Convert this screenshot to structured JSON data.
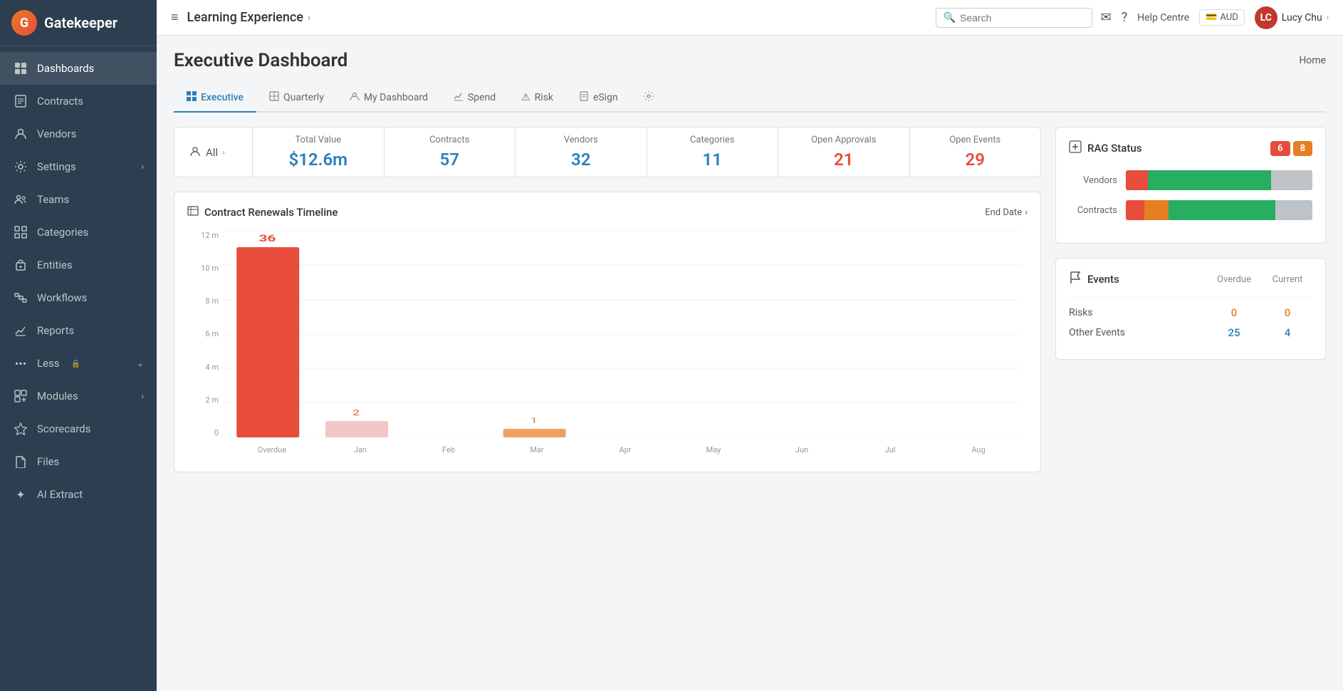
{
  "app": {
    "name": "Gatekeeper",
    "logo_letter": "G"
  },
  "topbar": {
    "menu_icon": "≡",
    "breadcrumb": "Learning Experience",
    "breadcrumb_arrow": "›",
    "search_placeholder": "Search",
    "help_centre": "Help Centre",
    "currency": "AUD",
    "user_name": "Lucy Chu",
    "user_initials": "LC",
    "user_arrow": "›"
  },
  "sidebar": {
    "items": [
      {
        "id": "dashboards",
        "label": "Dashboards",
        "icon": "⊞",
        "active": true,
        "has_arrow": false
      },
      {
        "id": "contracts",
        "label": "Contracts",
        "icon": "📄",
        "active": false,
        "has_arrow": false
      },
      {
        "id": "vendors",
        "label": "Vendors",
        "icon": "👥",
        "active": false,
        "has_arrow": false
      },
      {
        "id": "settings",
        "label": "Settings",
        "icon": "⚙",
        "active": false,
        "has_arrow": true
      },
      {
        "id": "teams",
        "label": "Teams",
        "icon": "👤",
        "active": false,
        "has_arrow": false
      },
      {
        "id": "categories",
        "label": "Categories",
        "icon": "▦",
        "active": false,
        "has_arrow": false
      },
      {
        "id": "entities",
        "label": "Entities",
        "icon": "🏢",
        "active": false,
        "has_arrow": false
      },
      {
        "id": "workflows",
        "label": "Workflows",
        "icon": "📊",
        "active": false,
        "has_arrow": false
      },
      {
        "id": "reports",
        "label": "Reports",
        "icon": "📈",
        "active": false,
        "has_arrow": false
      },
      {
        "id": "less",
        "label": "Less",
        "icon": "•••",
        "active": false,
        "has_arrow": true,
        "has_lock": true
      },
      {
        "id": "modules",
        "label": "Modules",
        "icon": "⊟",
        "active": false,
        "has_arrow": true
      },
      {
        "id": "scorecards",
        "label": "Scorecards",
        "icon": "🏆",
        "active": false,
        "has_arrow": false
      },
      {
        "id": "files",
        "label": "Files",
        "icon": "📁",
        "active": false,
        "has_arrow": false
      },
      {
        "id": "ai-extract",
        "label": "AI Extract",
        "icon": "✦",
        "active": false,
        "has_arrow": false
      }
    ]
  },
  "page": {
    "title": "Executive Dashboard",
    "home_label": "Home"
  },
  "tabs": [
    {
      "id": "executive",
      "label": "Executive",
      "icon": "⊞",
      "active": true
    },
    {
      "id": "quarterly",
      "label": "Quarterly",
      "icon": "⊟",
      "active": false
    },
    {
      "id": "my-dashboard",
      "label": "My Dashboard",
      "icon": "👤",
      "active": false
    },
    {
      "id": "spend",
      "label": "Spend",
      "icon": "📈",
      "active": false
    },
    {
      "id": "risk",
      "label": "Risk",
      "icon": "⚠",
      "active": false
    },
    {
      "id": "esign",
      "label": "eSign",
      "icon": "📄",
      "active": false
    },
    {
      "id": "settings-tab",
      "label": "",
      "icon": "⚙",
      "active": false
    }
  ],
  "stats": {
    "all_label": "All",
    "items": [
      {
        "id": "total-value",
        "label": "Total Value",
        "value": "$12.6m"
      },
      {
        "id": "contracts",
        "label": "Contracts",
        "value": "57"
      },
      {
        "id": "vendors",
        "label": "Vendors",
        "value": "32"
      },
      {
        "id": "categories",
        "label": "Categories",
        "value": "11"
      }
    ],
    "open_approvals": {
      "label": "Open Approvals",
      "value": "21"
    },
    "open_events": {
      "label": "Open Events",
      "value": "29"
    }
  },
  "chart": {
    "title": "Contract Renewals Timeline",
    "filter_label": "End Date",
    "filter_arrow": "›",
    "y_labels": [
      "12 m",
      "10 m",
      "8 m",
      "6 m",
      "4 m",
      "2 m",
      "0"
    ],
    "bars": [
      {
        "label": "Overdue",
        "value": 36,
        "color": "#e74c3c",
        "height_pct": 92,
        "show_label": true
      },
      {
        "label": "Jan",
        "value": 2,
        "color": "#f5c6c6",
        "height_pct": 8,
        "show_label": true,
        "label_color": "#e74c3c"
      },
      {
        "label": "Feb",
        "value": 0,
        "color": "#e67e22",
        "height_pct": 0,
        "show_label": false
      },
      {
        "label": "Mar",
        "value": 1,
        "color": "#e67e22",
        "height_pct": 3,
        "show_label": true,
        "label_color": "#e67e22"
      },
      {
        "label": "Apr",
        "value": 0,
        "color": "#27ae60",
        "height_pct": 0,
        "show_label": false
      },
      {
        "label": "May",
        "value": 0,
        "color": "#27ae60",
        "height_pct": 0,
        "show_label": false
      },
      {
        "label": "Jun",
        "value": 0,
        "color": "#27ae60",
        "height_pct": 0,
        "show_label": false
      },
      {
        "label": "Jul",
        "value": 0,
        "color": "#27ae60",
        "height_pct": 0,
        "show_label": false
      },
      {
        "label": "Aug",
        "value": 0,
        "color": "#27ae60",
        "height_pct": 0,
        "show_label": false
      }
    ]
  },
  "rag": {
    "title": "RAG Status",
    "badge_red": "6",
    "badge_orange": "8",
    "rows": [
      {
        "label": "Vendors",
        "segments": [
          {
            "color": "#e74c3c",
            "pct": 12
          },
          {
            "color": "#27ae60",
            "pct": 66
          },
          {
            "color": "#bdc3c7",
            "pct": 22
          }
        ]
      },
      {
        "label": "Contracts",
        "segments": [
          {
            "color": "#e74c3c",
            "pct": 10
          },
          {
            "color": "#e67e22",
            "pct": 13
          },
          {
            "color": "#27ae60",
            "pct": 57
          },
          {
            "color": "#bdc3c7",
            "pct": 20
          }
        ]
      }
    ]
  },
  "events": {
    "title": "Events",
    "col_overdue": "Overdue",
    "col_current": "Current",
    "rows": [
      {
        "label": "Risks",
        "overdue": "0",
        "current": "0",
        "overdue_class": "orange",
        "current_class": "orange"
      },
      {
        "label": "Other Events",
        "overdue": "25",
        "current": "4",
        "overdue_class": "blue",
        "current_class": "blue"
      }
    ]
  }
}
